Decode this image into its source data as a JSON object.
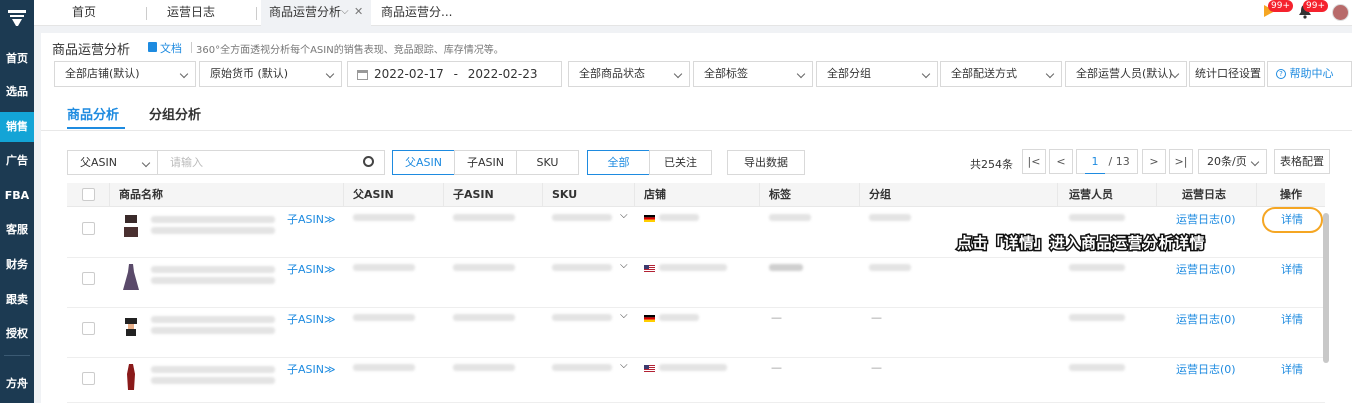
{
  "sidebar": {
    "items": [
      {
        "label": "首页"
      },
      {
        "label": "选品"
      },
      {
        "label": "销售"
      },
      {
        "label": "广告"
      },
      {
        "label": "FBA"
      },
      {
        "label": "客服"
      },
      {
        "label": "财务"
      },
      {
        "label": "跟卖"
      },
      {
        "label": "授权"
      },
      {
        "label": "方舟"
      }
    ]
  },
  "tabs": [
    {
      "label": "首页"
    },
    {
      "label": "运营日志"
    },
    {
      "label": "商品运营分析"
    },
    {
      "label": "商品运营分..."
    }
  ],
  "header": {
    "badge1": "99+",
    "badge2": "99+"
  },
  "page": {
    "title": "商品运营分析",
    "doc_link": "文档",
    "description": "360°全方面透视分析每个ASIN的销售表现、竞品跟踪、库存情况等。"
  },
  "filters": {
    "store": "全部店铺(默认)",
    "currency": "原始货币 (默认)",
    "date_start": "2022-02-17",
    "date_sep": "-",
    "date_end": "2022-02-23",
    "product_status": "全部商品状态",
    "tags": "全部标签",
    "groups": "全部分组",
    "shipping": "全部配送方式",
    "operators": "全部运营人员(默认)",
    "stats_setting": "统计口径设置",
    "help": "帮助中心"
  },
  "page_tabs": [
    {
      "label": "商品分析"
    },
    {
      "label": "分组分析"
    }
  ],
  "toolbar": {
    "search_type": "父ASIN",
    "search_placeholder": "请输入",
    "asin_toggle": [
      "父ASIN",
      "子ASIN",
      "SKU"
    ],
    "follow_toggle": [
      "全部",
      "已关注"
    ],
    "export": "导出数据",
    "total": "共254条",
    "current_page": "1",
    "total_pages": "/ 13",
    "page_size": "20条/页",
    "table_config": "表格配置"
  },
  "table": {
    "headers": [
      "商品名称",
      "父ASIN",
      "子ASIN",
      "SKU",
      "店铺",
      "标签",
      "分组",
      "运营人员",
      "运营日志",
      "操作"
    ],
    "rows": [
      {
        "child_asin": "子ASIN",
        "tag": "",
        "group": "",
        "log": "运营日志(0)",
        "action": "详情",
        "flag": "de"
      },
      {
        "child_asin": "子ASIN",
        "tag": "",
        "group": "",
        "log": "运营日志(0)",
        "action": "详情",
        "flag": "us"
      },
      {
        "child_asin": "子ASIN",
        "tag": "—",
        "group": "—",
        "log": "运营日志(0)",
        "action": "详情",
        "flag": "de"
      },
      {
        "child_asin": "子ASIN",
        "tag": "—",
        "group": "—",
        "log": "运营日志(0)",
        "action": "详情",
        "flag": "us"
      }
    ]
  },
  "annotation": "点击「详情」进入商品运营分析详情",
  "colors": {
    "accent": "#1e8be0",
    "sidebar": "#1c3a52",
    "sidebar_active": "#13a4d6",
    "highlight": "#f5a623"
  }
}
